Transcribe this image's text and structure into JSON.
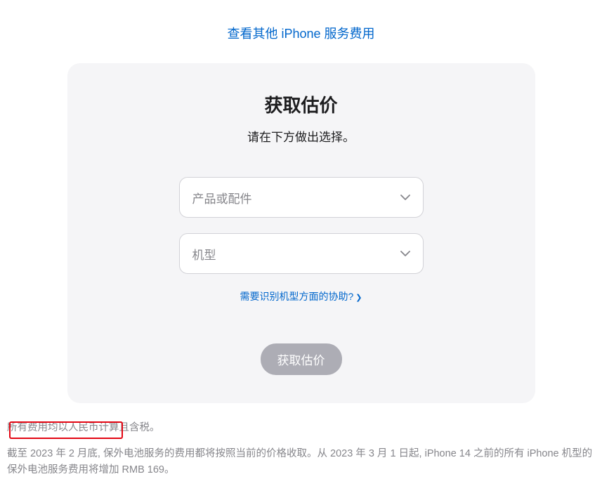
{
  "top_link": {
    "text": "查看其他 iPhone 服务费用"
  },
  "panel": {
    "title": "获取估价",
    "subtitle": "请在下方做出选择。",
    "select1": {
      "placeholder": "产品或配件"
    },
    "select2": {
      "placeholder": "机型"
    },
    "help_link": "需要识别机型方面的协助?",
    "submit_label": "获取估价"
  },
  "footer": {
    "line1": "所有费用均以人民币计算且含税。",
    "line2": "截至 2023 年 2 月底, 保外电池服务的费用都将按照当前的价格收取。从 2023 年 3 月 1 日起, iPhone 14 之前的所有 iPhone 机型的保外电池服务费用将增加 RMB 169。"
  }
}
